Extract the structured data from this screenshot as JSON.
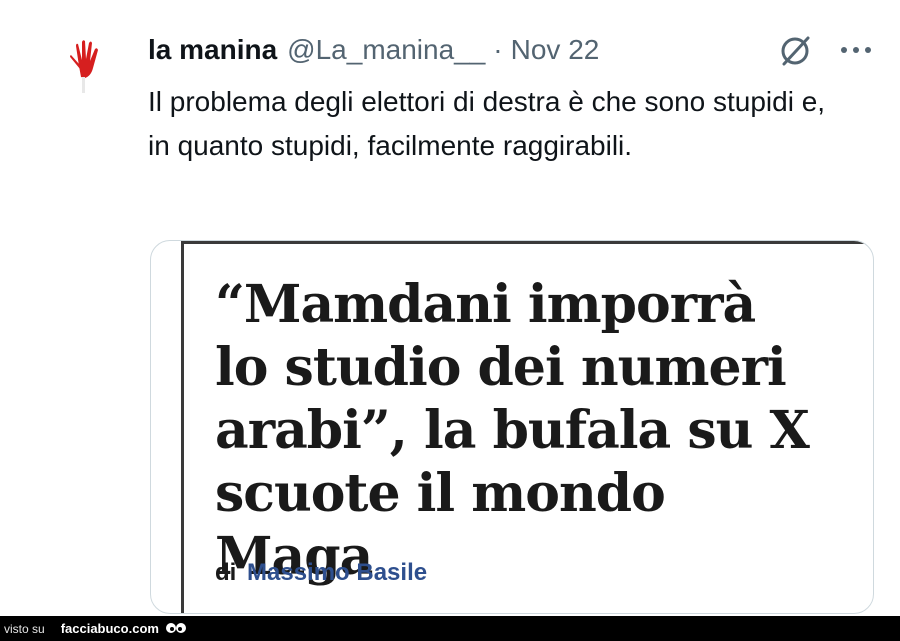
{
  "tweet": {
    "display_name": "la manina",
    "handle": "@La_manina__",
    "separator": "·",
    "date": "Nov 22",
    "text": "Il problema degli elettori di destra è che sono stupidi e, in quanto stupidi, facilmente raggirabili."
  },
  "card": {
    "headline": "“Mamdani imporrà lo studio dei numeri arabi”, la bufala su X scuote il mondo Maga",
    "byline_prefix": "di",
    "byline_author": "Massimo Basile"
  },
  "watermark": {
    "prefix": "visto su",
    "brand": "facciabuco.com"
  },
  "icons": {
    "avatar": "red-hand-icon",
    "grok": "grok-icon",
    "more": "more-options-icon",
    "watermark": "eyes-icon"
  },
  "colors": {
    "text": "#0f1419",
    "secondary": "#536471",
    "byline_author": "#2e4f8e",
    "avatar_hand": "#d61f1f"
  }
}
